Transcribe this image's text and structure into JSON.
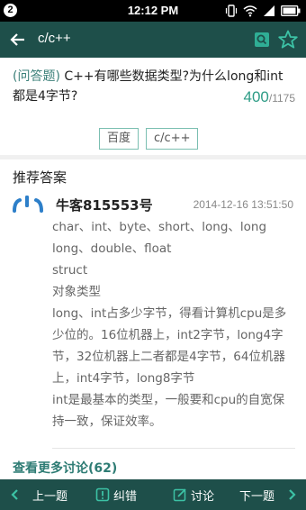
{
  "status_bar": {
    "notification_badge": "2",
    "time": "12:12 PM"
  },
  "toolbar": {
    "title": "c/c++",
    "back_icon": "arrow-left-icon",
    "actions": [
      "search-doc-icon",
      "star-icon"
    ]
  },
  "question": {
    "tag": "(问答题)",
    "text": "C++有哪些数据类型?为什么long和int都是4字节?",
    "views": "400",
    "total": "/1175"
  },
  "tags": [
    "百度",
    "c/c++"
  ],
  "recommended": {
    "section_title": "推荐答案",
    "username": "牛客815553号",
    "timestamp": "2014-12-16 13:51:50",
    "lines": [
      "char、int、byte、short、long、long long、double、float",
      "struct",
      "对象类型",
      "long、int占多少字节，得看计算机cpu是多少位的。16位机器上，int2字节，long4字节，32位机器上二者都是4字节，64位机器上，int4字节，long8字节",
      "int是最基本的类型，一般要和cpu的自宽保持一致，保证效率。"
    ]
  },
  "more_link": "查看更多讨论(62)",
  "bottom_bar": {
    "prev": "上一题",
    "report": "纠错",
    "discuss": "讨论",
    "next": "下一题"
  },
  "colors": {
    "toolbar_bg": "#1e4f4a",
    "accent": "#2e9c86",
    "tag_border": "#7bbfb1"
  }
}
